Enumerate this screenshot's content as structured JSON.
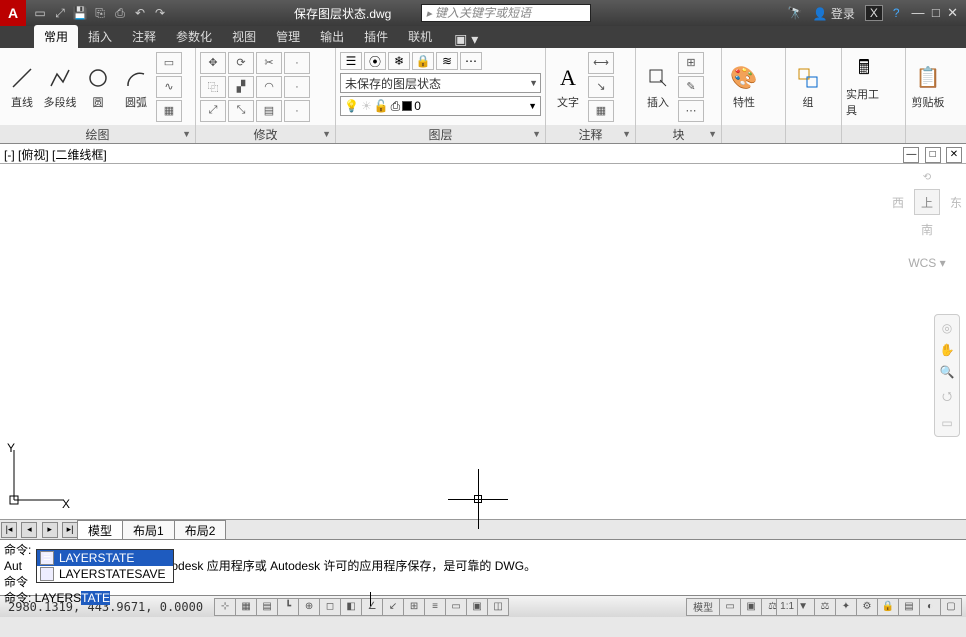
{
  "title": {
    "doc": "保存图层状态.dwg",
    "search_ph": "键入关键字或短语",
    "login": "登录"
  },
  "tabs": {
    "items": [
      "常用",
      "插入",
      "注释",
      "参数化",
      "视图",
      "管理",
      "输出",
      "插件",
      "联机"
    ],
    "active": 0
  },
  "ribbon": {
    "draw": {
      "title": "绘图",
      "line": "直线",
      "pline": "多段线",
      "circle": "圆",
      "arc": "圆弧"
    },
    "modify": {
      "title": "修改"
    },
    "layer": {
      "title": "图层",
      "state": "未保存的图层状态",
      "current": "0"
    },
    "annot": {
      "title": "注释",
      "text": "文字"
    },
    "block": {
      "title": "块",
      "insert": "插入"
    },
    "props": {
      "title": "特性"
    },
    "group": {
      "title": "组"
    },
    "util": {
      "title": "实用工具"
    },
    "clip": {
      "title": "剪贴板"
    }
  },
  "view": {
    "label": "[-] [俯视] [二维线框]",
    "cube_top": "上",
    "wcs": "WCS"
  },
  "layouts": {
    "model": "模型",
    "l1": "布局1",
    "l2": "布局2"
  },
  "cmd": {
    "l1": "命令:",
    "l2_a": "Aut",
    "l2_b": "件上次由 Autodesk 应用程序或 Autodesk 许可的应用程序保存，是可靠的 DWG。",
    "l3": "命令",
    "prompt": "命令: LAYERS",
    "prompt_hl": "TATE",
    "ac1": "LAYERSTATE",
    "ac2": "LAYERSTATESAVE"
  },
  "status": {
    "coords": "2980.1319, 443.9671, 0.0000",
    "model": "模型",
    "scale": "1:1"
  }
}
